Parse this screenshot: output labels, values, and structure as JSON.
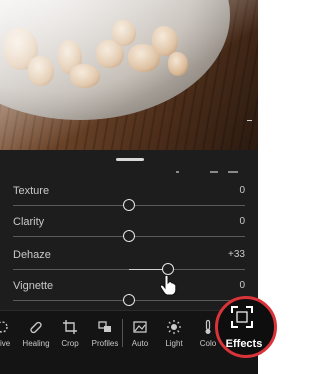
{
  "sliders": [
    {
      "label": "Texture",
      "value": "0",
      "level": 0.5
    },
    {
      "label": "Clarity",
      "value": "0",
      "level": 0.5
    },
    {
      "label": "Dehaze",
      "value": "+33",
      "level": 0.67
    },
    {
      "label": "Vignette",
      "value": "0",
      "level": 0.5
    }
  ],
  "toolbar": {
    "items": [
      {
        "label": "ctive",
        "icon": "selective-icon"
      },
      {
        "label": "Healing",
        "icon": "bandage-icon"
      },
      {
        "label": "Crop",
        "icon": "crop-icon"
      },
      {
        "label": "Profiles",
        "icon": "profiles-icon"
      },
      {
        "label": "Auto",
        "icon": "auto-icon"
      },
      {
        "label": "Light",
        "icon": "sun-icon"
      },
      {
        "label": "Colo",
        "icon": "thermometer-icon"
      }
    ],
    "effects": {
      "label": "Effects",
      "icon": "effects-icon",
      "highlight_color": "#d8343a"
    }
  },
  "colors": {
    "panel_bg": "#1d1d1d",
    "toolbar_bg": "#141414",
    "text": "#c9c9c9"
  }
}
